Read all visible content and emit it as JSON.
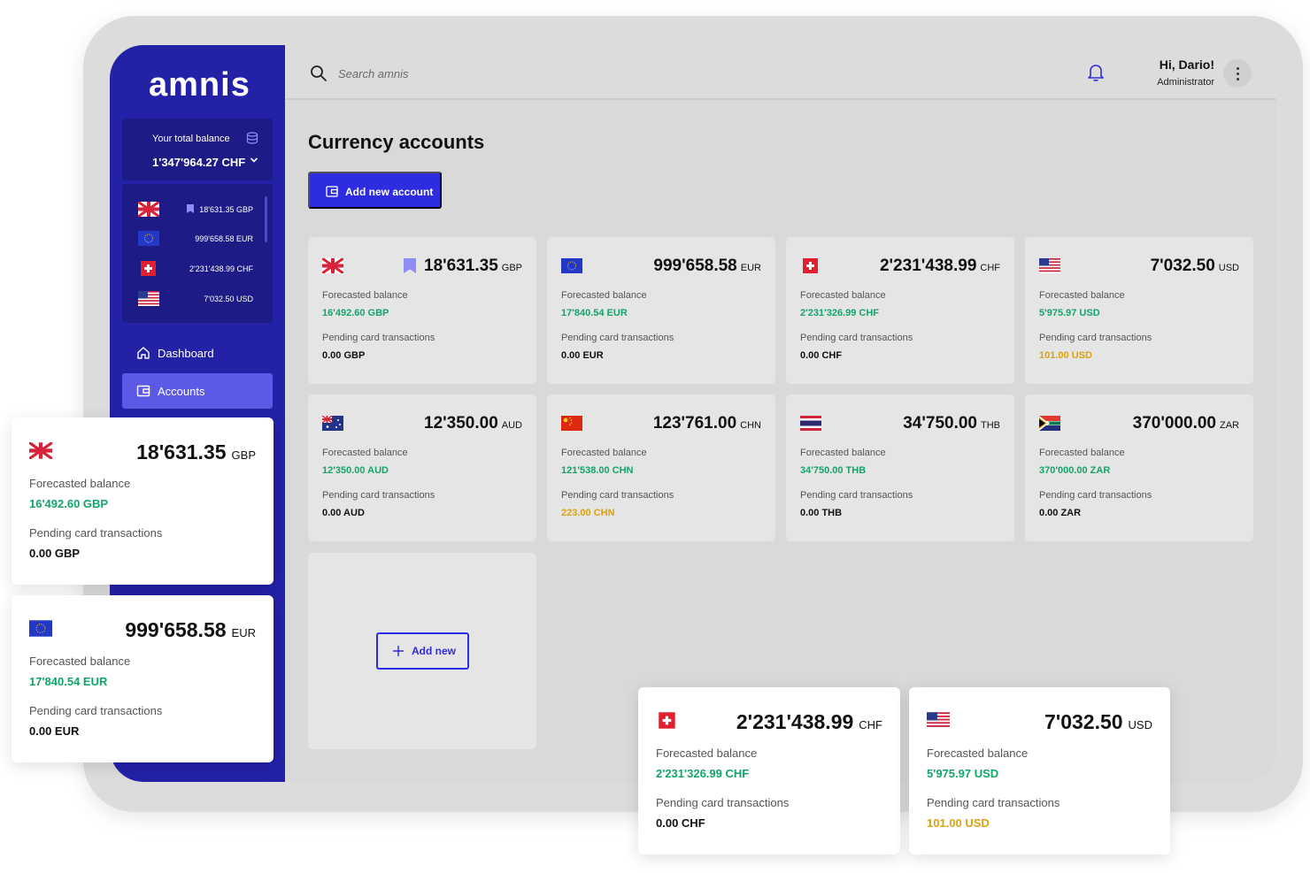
{
  "app": {
    "logo": "amnis"
  },
  "sidebar": {
    "total_label": "Your total balance",
    "total_value": "1'347'964.27 CHF",
    "accounts": [
      {
        "flag": "gb-flag",
        "amount": "18'631.35 GBP",
        "bookmarked": true
      },
      {
        "flag": "eu-flag",
        "amount": "999'658.58 EUR"
      },
      {
        "flag": "ch-flag",
        "amount": "2'231'438.99 CHF"
      },
      {
        "flag": "us-flag",
        "amount": "7'032.50 USD"
      }
    ],
    "nav": [
      {
        "label": "Dashboard",
        "icon": "home-icon",
        "active": false
      },
      {
        "label": "Accounts",
        "icon": "wallet-icon",
        "active": true
      }
    ]
  },
  "header": {
    "search_placeholder": "Search amnis",
    "greeting": "Hi, Dario!",
    "role": "Administrator"
  },
  "main": {
    "title": "Currency accounts",
    "add_account_label": "Add new account",
    "add_new_label": "Add new",
    "forecast_label": "Forecasted balance",
    "pending_label": "Pending card transactions",
    "cards": [
      {
        "flag": "gb-flag",
        "amount": "18'631.35",
        "currency": "GBP",
        "forecast": "16'492.60 GBP",
        "pending": "0.00 GBP",
        "bookmarked": true
      },
      {
        "flag": "eu-flag",
        "amount": "999'658.58",
        "currency": "EUR",
        "forecast": "17'840.54 EUR",
        "pending": "0.00 EUR"
      },
      {
        "flag": "ch-flag",
        "amount": "2'231'438.99",
        "currency": "CHF",
        "forecast": "2'231'326.99 CHF",
        "pending": "0.00 CHF"
      },
      {
        "flag": "us-flag",
        "amount": "7'032.50",
        "currency": "USD",
        "forecast": "5'975.97 USD",
        "pending": "101.00 USD"
      },
      {
        "flag": "au-flag",
        "amount": "12'350.00",
        "currency": "AUD",
        "forecast": "12'350.00 AUD",
        "pending": "0.00 AUD"
      },
      {
        "flag": "cn-flag",
        "amount": "123'761.00",
        "currency": "CHN",
        "forecast": "121'538.00 CHN",
        "pending": "223.00 CHN"
      },
      {
        "flag": "th-flag",
        "amount": "34'750.00",
        "currency": "THB",
        "forecast": "34'750.00 THB",
        "pending": "0.00 THB"
      },
      {
        "flag": "za-flag",
        "amount": "370'000.00",
        "currency": "ZAR",
        "forecast": "370'000.00 ZAR",
        "pending": "0.00 ZAR"
      }
    ]
  },
  "floating_cards": [
    {
      "flag": "gb-flag",
      "amount": "18'631.35",
      "currency": "GBP",
      "forecast": "16'492.60 GBP",
      "pending": "0.00 GBP"
    },
    {
      "flag": "eu-flag",
      "amount": "999'658.58",
      "currency": "EUR",
      "forecast": "17'840.54 EUR",
      "pending": "0.00 EUR"
    },
    {
      "flag": "ch-flag",
      "amount": "2'231'438.99",
      "currency": "CHF",
      "forecast": "2'231'326.99 CHF",
      "pending": "0.00 CHF"
    },
    {
      "flag": "us-flag",
      "amount": "7'032.50",
      "currency": "USD",
      "forecast": "5'975.97 USD",
      "pending": "101.00 USD"
    }
  ],
  "colors": {
    "sidebar": "#2321a6",
    "accent": "#2e2ce0",
    "positive": "#12a56a",
    "warning": "#dca10f"
  }
}
